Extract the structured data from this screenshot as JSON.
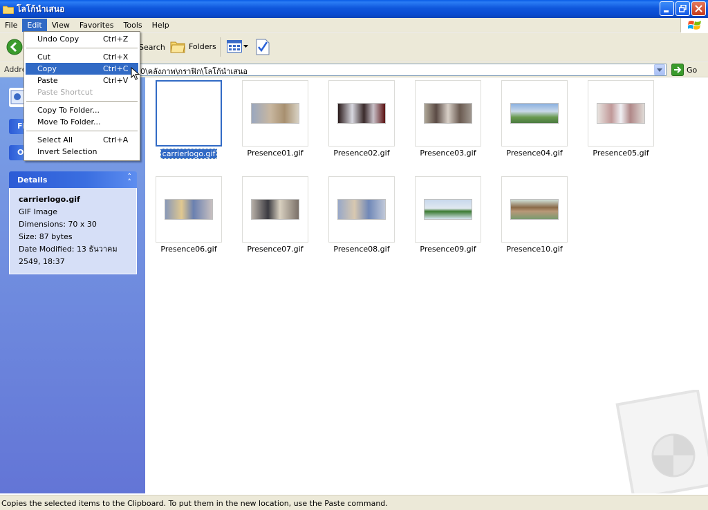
{
  "window": {
    "title": "โลโก้นำเสนอ"
  },
  "menubar": {
    "items": [
      {
        "label": "File"
      },
      {
        "label": "Edit"
      },
      {
        "label": "View"
      },
      {
        "label": "Favorites"
      },
      {
        "label": "Tools"
      },
      {
        "label": "Help"
      }
    ],
    "active": "Edit"
  },
  "toolbar": {
    "search_label": "Search",
    "folders_label": "Folders"
  },
  "address": {
    "label": "Addre",
    "path": "0\\คลังภาพ\\กราฟิก\\โลโก้นำเสนอ",
    "go_label": "Go"
  },
  "edit_menu": {
    "items": [
      {
        "label": "Undo Copy",
        "shortcut": "Ctrl+Z"
      },
      {
        "label": "Cut",
        "shortcut": "Ctrl+X"
      },
      {
        "label": "Copy",
        "shortcut": "Ctrl+C",
        "highlighted": true
      },
      {
        "label": "Paste",
        "shortcut": "Ctrl+V"
      },
      {
        "label": "Paste Shortcut",
        "shortcut": "",
        "disabled": true
      },
      {
        "label": "Copy To Folder...",
        "shortcut": ""
      },
      {
        "label": "Move To Folder...",
        "shortcut": ""
      },
      {
        "label": "Select All",
        "shortcut": "Ctrl+A"
      },
      {
        "label": "Invert Selection",
        "shortcut": ""
      }
    ]
  },
  "left_pane": {
    "stubs": [
      {
        "label": "Fi"
      },
      {
        "label": "O"
      }
    ],
    "details": {
      "title": "Details",
      "name": "carrierlogo.gif",
      "type": "GIF Image",
      "dimensions": "Dimensions: 70 x 30",
      "size": "Size: 87 bytes",
      "modified": "Date Modified: 13 ธันวาคม 2549, 18:37"
    }
  },
  "files": [
    {
      "name": "carrierlogo.gif",
      "selected": true
    },
    {
      "name": "Presence01.gif"
    },
    {
      "name": "Presence02.gif"
    },
    {
      "name": "Presence03.gif"
    },
    {
      "name": "Presence04.gif"
    },
    {
      "name": "Presence05.gif"
    },
    {
      "name": "Presence06.gif"
    },
    {
      "name": "Presence07.gif"
    },
    {
      "name": "Presence08.gif"
    },
    {
      "name": "Presence09.gif"
    },
    {
      "name": "Presence10.gif"
    }
  ],
  "statusbar": {
    "text": "Copies the selected items to the Clipboard. To put them in the new location, use the Paste command."
  },
  "colors": {
    "titlebar": "#0a4bd0",
    "selection": "#316ac5",
    "pane": "#6f8ee0",
    "menubar": "#ece9d8"
  }
}
